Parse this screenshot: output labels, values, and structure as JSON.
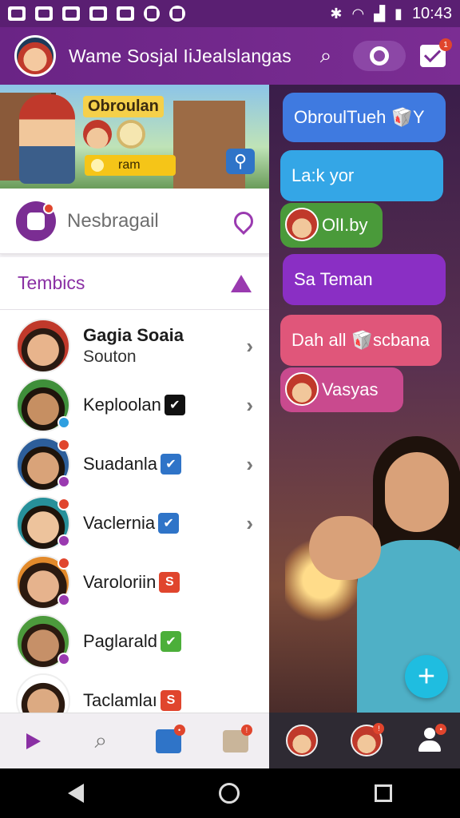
{
  "status_bar": {
    "time": "10:43"
  },
  "header": {
    "title": "Wame Sosjal IiJealslangas"
  },
  "hero": {
    "title": "Obroulan",
    "bar_text": "ram"
  },
  "search": {
    "placeholder": "Nesbragail"
  },
  "section": {
    "title": "Tembics"
  },
  "contacts": [
    {
      "name": "Gagia Soaia",
      "sub": "Souton"
    },
    {
      "name": "Keploolan"
    },
    {
      "name": "Suadanla"
    },
    {
      "name": "Vaclernia"
    },
    {
      "name": "Varoloriin"
    },
    {
      "name": "Paglarald"
    },
    {
      "name": "Taclamlaı"
    }
  ],
  "messages": [
    {
      "text": "ObroulTueh 🥡Y"
    },
    {
      "text": "La:k yor"
    },
    {
      "text": "OlI.by"
    },
    {
      "text": "Sa Teman"
    },
    {
      "text": "Dah all 🥡scbana"
    },
    {
      "text": "Vasyas"
    }
  ],
  "badges": {
    "verify_s": "S"
  }
}
